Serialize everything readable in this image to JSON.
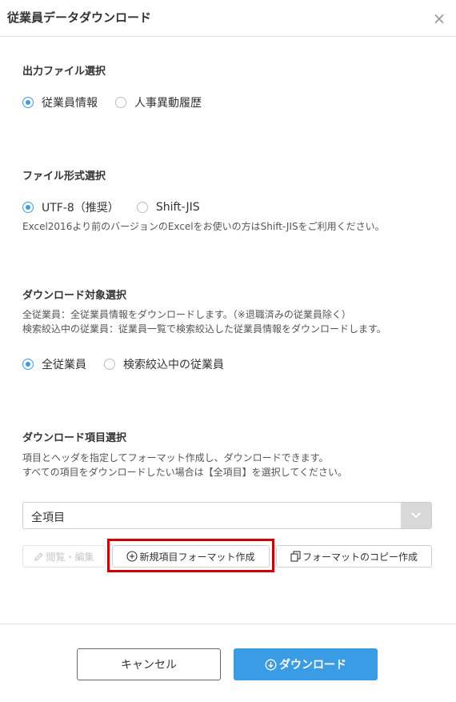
{
  "dialog": {
    "title": "従業員データダウンロード",
    "close_icon": "×"
  },
  "output_file": {
    "title": "出力ファイル選択",
    "options": [
      {
        "label": "従業員情報",
        "checked": true
      },
      {
        "label": "人事異動履歴",
        "checked": false
      }
    ]
  },
  "file_format": {
    "title": "ファイル形式選択",
    "options": [
      {
        "label": "UTF-8（推奨）",
        "checked": true
      },
      {
        "label": "Shift-JIS",
        "checked": false
      }
    ],
    "note": "Excel2016より前のバージョンのExcelをお使いの方はShift-JISをご利用ください。"
  },
  "target": {
    "title": "ダウンロード対象選択",
    "note_line1": "全従業員：全従業員情報をダウンロードします。（※退職済みの従業員除く）",
    "note_line2": "検索絞込中の従業員：従業員一覧で検索絞込した従業員情報をダウンロードします。",
    "options": [
      {
        "label": "全従業員",
        "checked": true
      },
      {
        "label": "検索絞込中の従業員",
        "checked": false
      }
    ]
  },
  "items": {
    "title": "ダウンロード項目選択",
    "note_line1": "項目とヘッダを指定してフォーマット作成し、ダウンロードできます。",
    "note_line2": "すべての項目をダウンロードしたい場合は【全項目】を選択してください。",
    "selected_value": "全項目",
    "view_edit_label": "閲覧・編集",
    "new_format_label": "新規項目フォーマット作成",
    "copy_format_label": "フォーマットのコピー作成"
  },
  "footer": {
    "cancel_label": "キャンセル",
    "download_label": "ダウンロード"
  },
  "colors": {
    "accent": "#3b9ce6",
    "highlight": "#d40000"
  }
}
